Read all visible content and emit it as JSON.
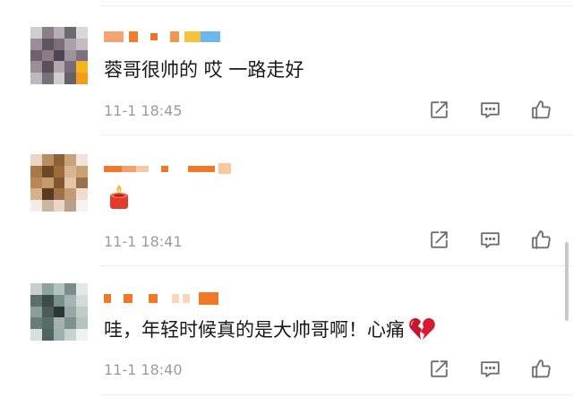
{
  "comments": [
    {
      "text": "蓉哥很帅的  哎  一路走好",
      "time": "11-1 18:45"
    },
    {
      "text": "",
      "emoji": "candle-emoji",
      "time": "11-1 18:41"
    },
    {
      "text": "哇，年轻时候真的是大帅哥啊！心痛",
      "emoji": "broken-heart-emoji",
      "time": "11-1 18:40"
    }
  ],
  "icons": {
    "share": "share-icon",
    "reply": "comment-icon",
    "like": "like-icon"
  },
  "colors": {
    "username_blur": "#f08a3c",
    "text": "#1a1a1a",
    "time": "#9b9b9b",
    "icon": "#707070"
  }
}
